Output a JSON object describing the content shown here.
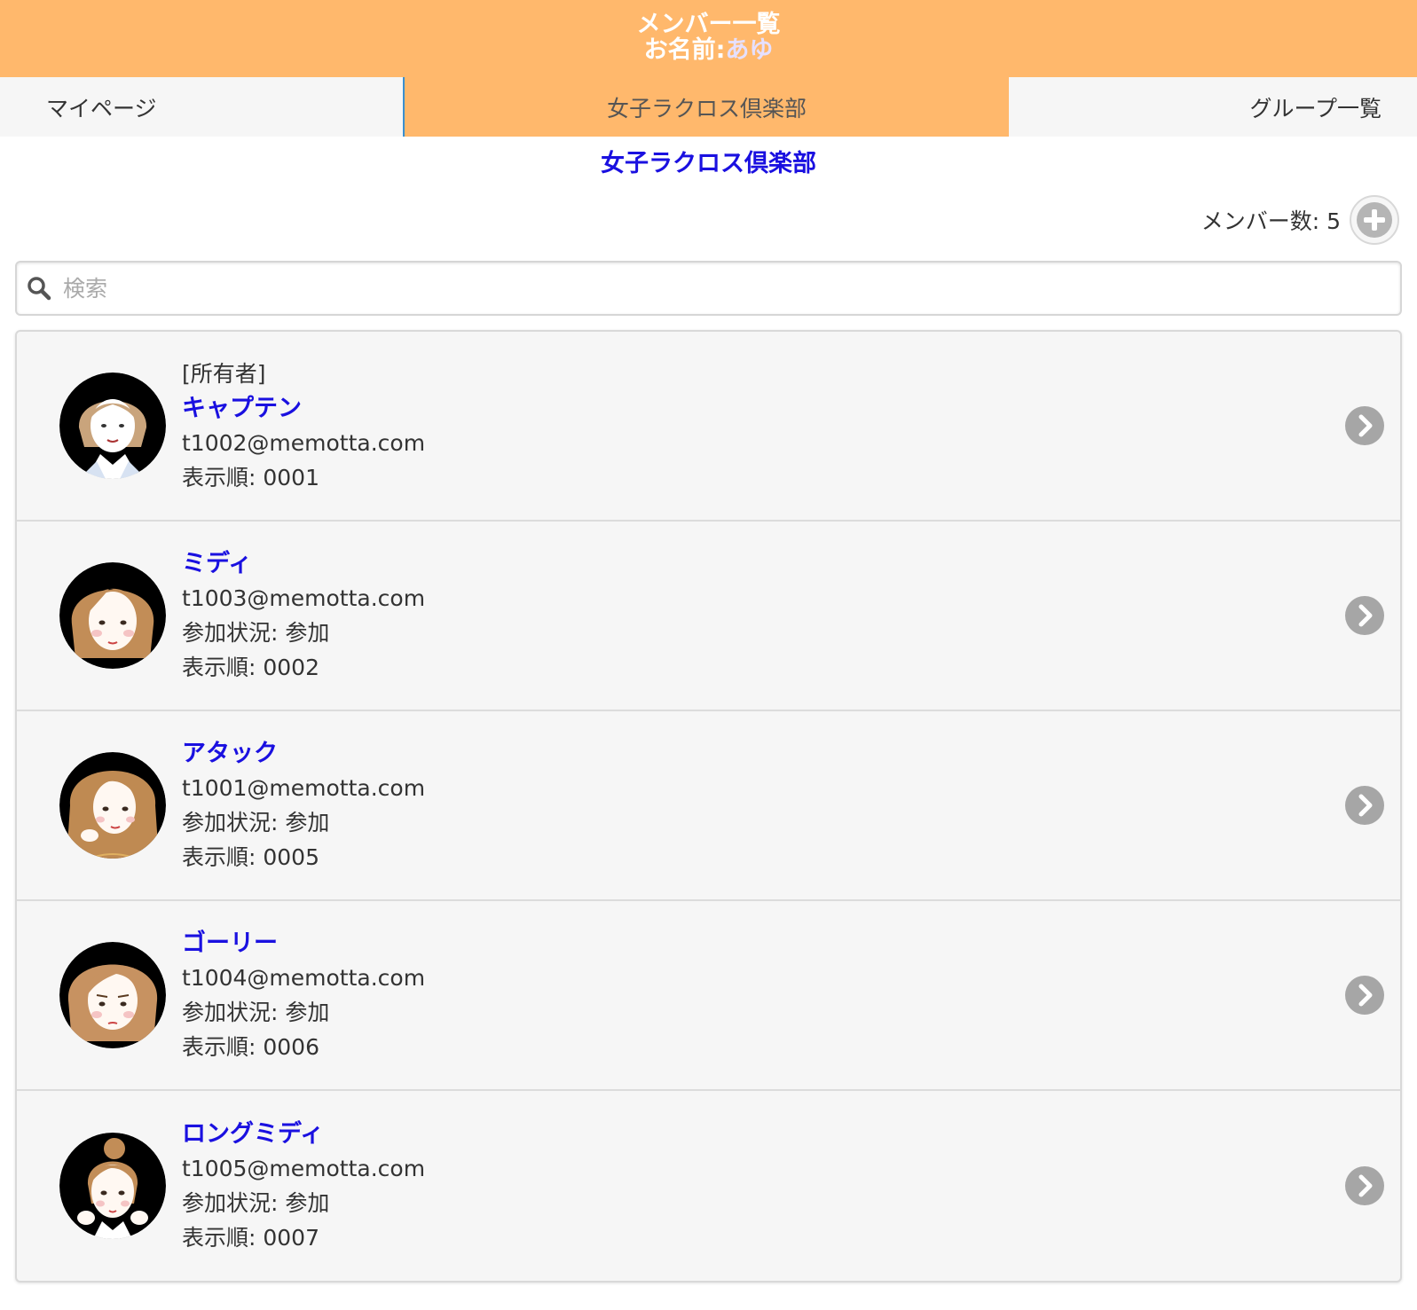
{
  "header": {
    "title": "メンバー一覧",
    "name_prefix": "お名前:",
    "user_name": "あゆ"
  },
  "tabs": {
    "left": "マイページ",
    "center": "女子ラクロス倶楽部",
    "right": "グループ一覧"
  },
  "group_title": "女子ラクロス倶楽部",
  "member_count_label": "メンバー数: 5",
  "search": {
    "placeholder": "検索"
  },
  "members": [
    {
      "role": "[所有者]",
      "name": "キャプテン",
      "email": "t1002@memotta.com",
      "status": "",
      "order": "表示順:  0001"
    },
    {
      "role": "",
      "name": "ミディ",
      "email": "t1003@memotta.com",
      "status": "参加状況:  参加",
      "order": "表示順:  0002"
    },
    {
      "role": "",
      "name": "アタック",
      "email": "t1001@memotta.com",
      "status": "参加状況:  参加",
      "order": "表示順:  0005"
    },
    {
      "role": "",
      "name": "ゴーリー",
      "email": "t1004@memotta.com",
      "status": "参加状況:  参加",
      "order": "表示順:  0006"
    },
    {
      "role": "",
      "name": "ロングミディ",
      "email": "t1005@memotta.com",
      "status": "参加状況:  参加",
      "order": "表示順:  0007"
    }
  ],
  "icons": {
    "search": "search-icon",
    "add": "plus-circle-icon",
    "chevron": "chevron-right-icon"
  },
  "colors": {
    "accent": "#FFB86C",
    "link": "#1a10e0",
    "list_bg": "#f6f6f6"
  }
}
